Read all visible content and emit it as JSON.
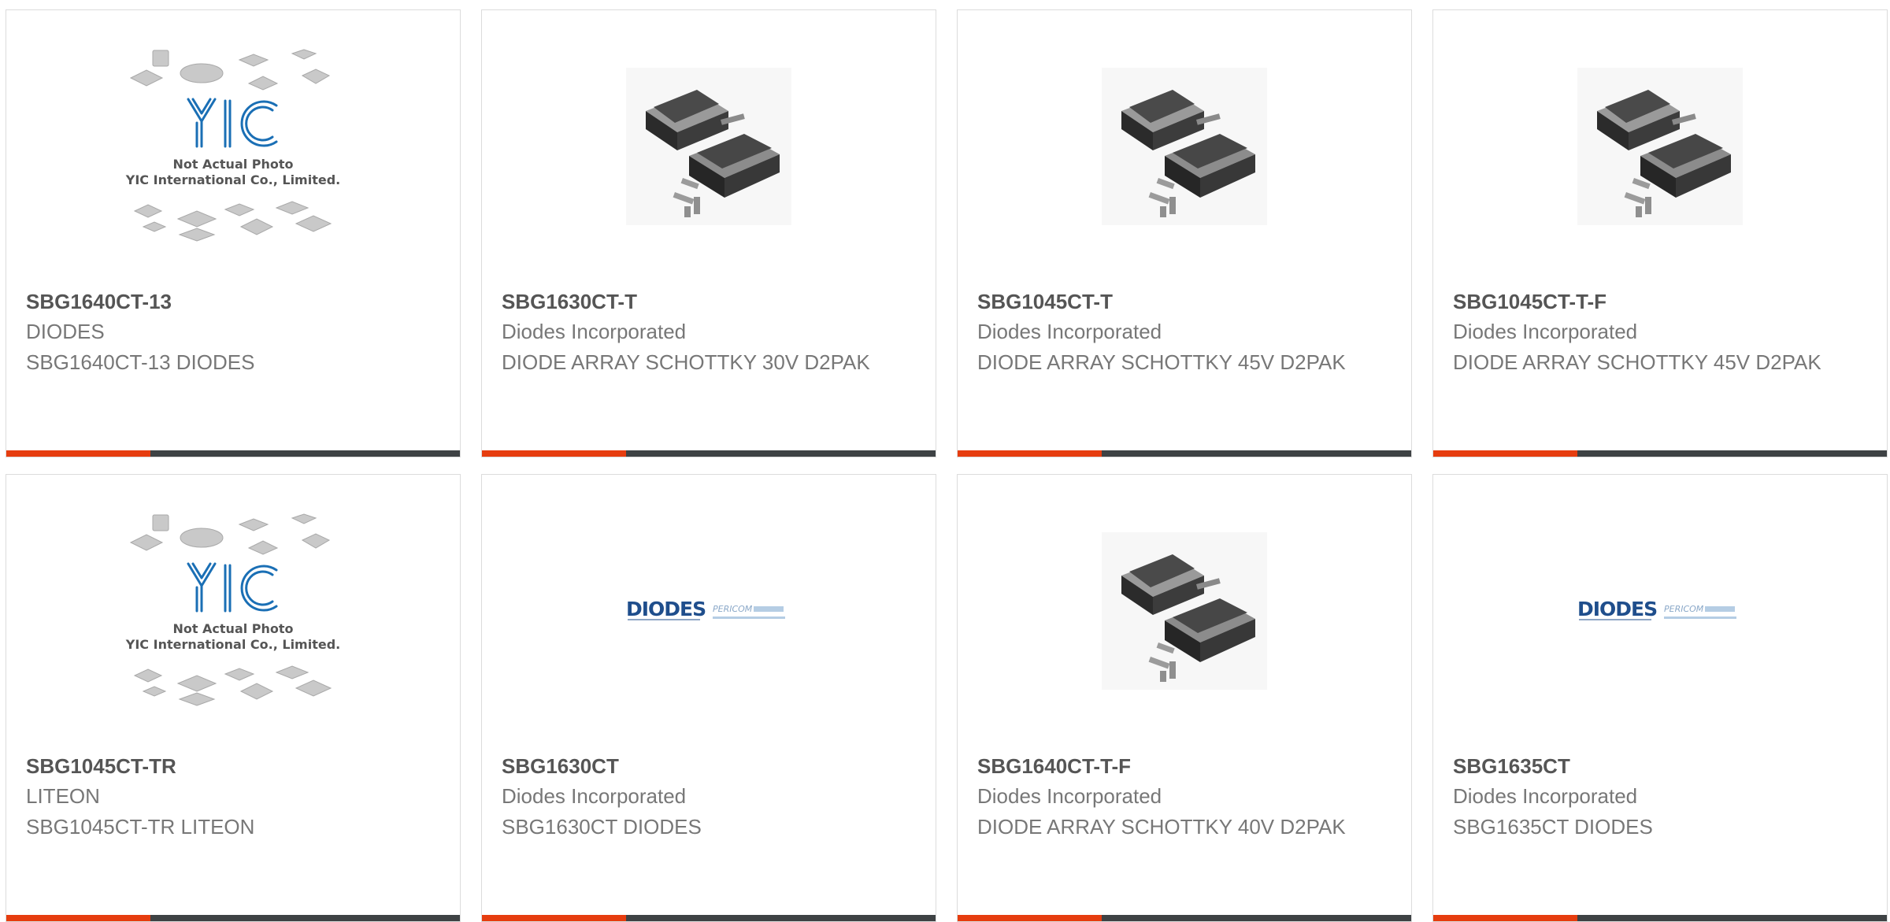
{
  "products": [
    {
      "part": "SBG1640CT-13",
      "manufacturer": "DIODES",
      "description": "SBG1640CT-13 DIODES",
      "image": "yic-placeholder-image"
    },
    {
      "part": "SBG1630CT-T",
      "manufacturer": "Diodes Incorporated",
      "description": "DIODE ARRAY SCHOTTKY 30V D2PAK",
      "image": "d2pak-package-image"
    },
    {
      "part": "SBG1045CT-T",
      "manufacturer": "Diodes Incorporated",
      "description": "DIODE ARRAY SCHOTTKY 45V D2PAK",
      "image": "d2pak-package-image"
    },
    {
      "part": "SBG1045CT-T-F",
      "manufacturer": "Diodes Incorporated",
      "description": "DIODE ARRAY SCHOTTKY 45V D2PAK",
      "image": "d2pak-package-image"
    },
    {
      "part": "SBG1045CT-TR",
      "manufacturer": "LITEON",
      "description": "SBG1045CT-TR LITEON",
      "image": "yic-placeholder-image"
    },
    {
      "part": "SBG1630CT",
      "manufacturer": "Diodes Incorporated",
      "description": "SBG1630CT DIODES",
      "image": "diodes-logo-image"
    },
    {
      "part": "SBG1640CT-T-F",
      "manufacturer": "Diodes Incorporated",
      "description": "DIODE ARRAY SCHOTTKY 40V D2PAK",
      "image": "d2pak-package-image"
    },
    {
      "part": "SBG1635CT",
      "manufacturer": "Diodes Incorporated",
      "description": "SBG1635CT DIODES",
      "image": "diodes-logo-image"
    }
  ],
  "placeholder": {
    "logo_text": "YIC",
    "caption_line1": "Not Actual Photo",
    "caption_line2": "YIC International Co., Limited."
  },
  "brand_logo": {
    "name": "DIODES",
    "partner": "PERICOM"
  },
  "colors": {
    "accent": "#e63d0f",
    "bar": "#3e4244",
    "title": "#555555",
    "text": "#777777",
    "yic_blue": "#1a6fb5",
    "diodes_blue": "#1f4e8c"
  }
}
